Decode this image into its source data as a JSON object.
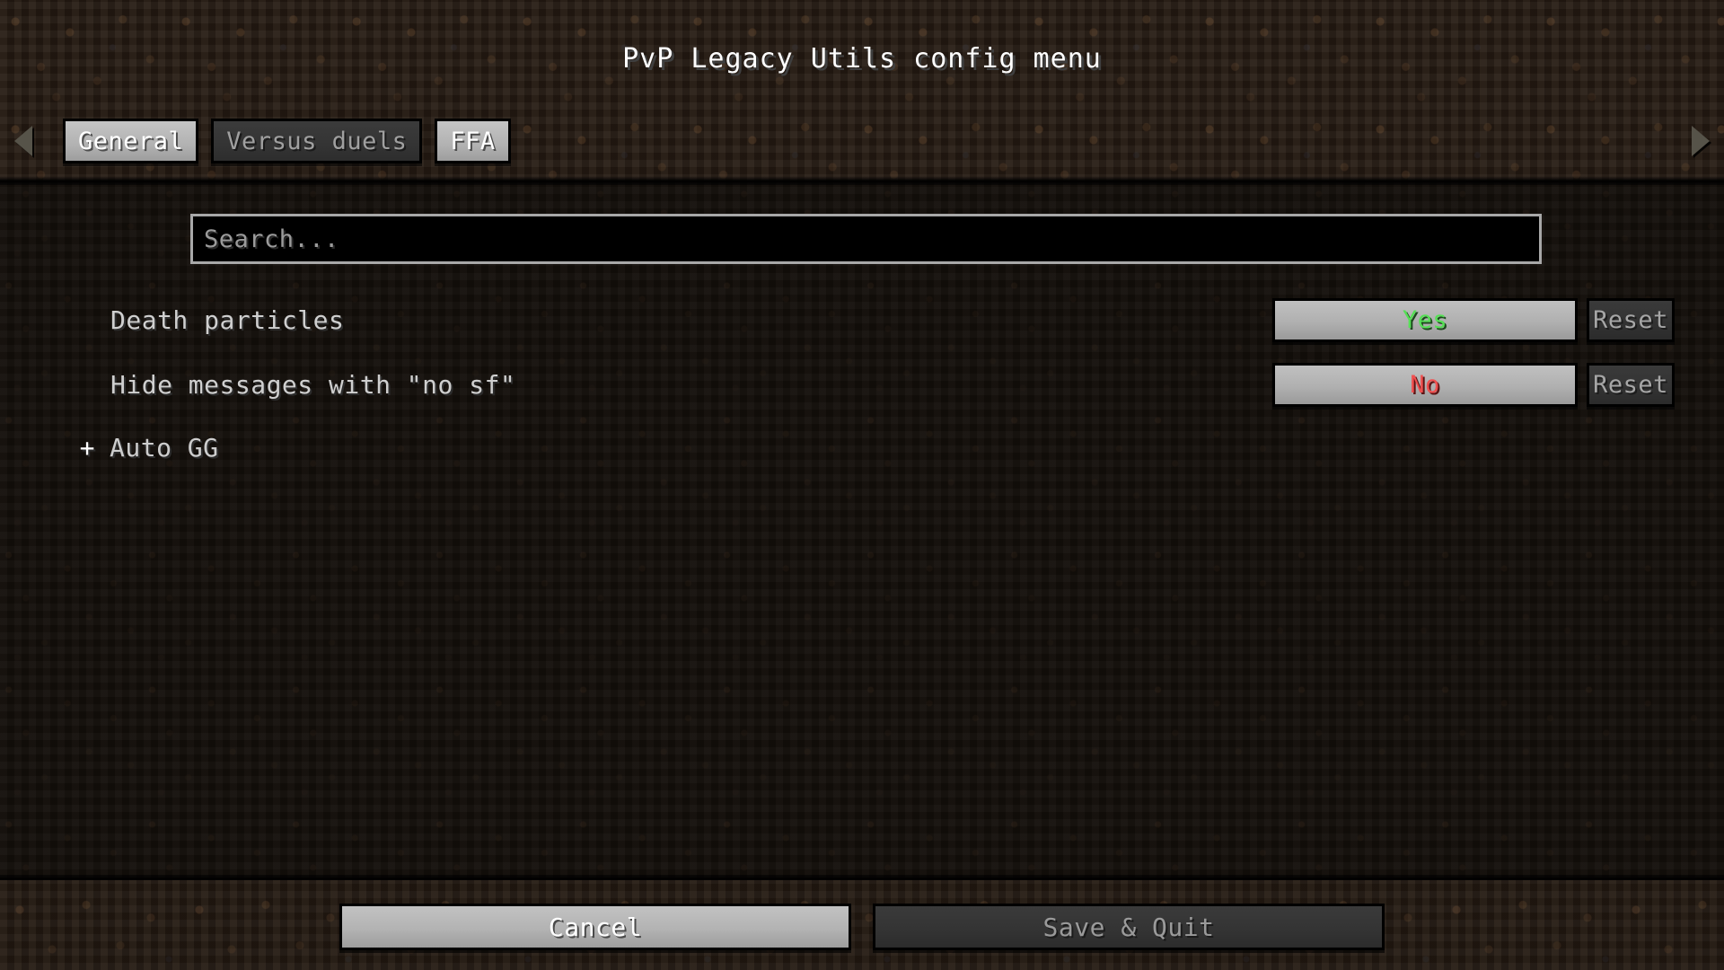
{
  "window": {
    "title": "PvP Legacy Utils config menu"
  },
  "tab_bar": {
    "prev_arrow_icon": "triangle-left-icon",
    "next_arrow_icon": "triangle-right-icon",
    "tabs": [
      {
        "label": "General",
        "state": "active"
      },
      {
        "label": "Versus duels",
        "state": "inactive"
      },
      {
        "label": "FFA",
        "state": "active"
      }
    ]
  },
  "search": {
    "placeholder": "Search...",
    "value": ""
  },
  "options": [
    {
      "label": "Death particles",
      "value": "Yes",
      "value_color": "#55e055",
      "reset_label": "Reset",
      "reset_enabled": false
    },
    {
      "label": "Hide messages with \"no sf\"",
      "value": "No",
      "value_color": "#f05050",
      "reset_label": "Reset",
      "reset_enabled": false
    }
  ],
  "categories": [
    {
      "toggle": "+",
      "label": "Auto GG",
      "expanded": false
    }
  ],
  "footer": {
    "cancel_label": "Cancel",
    "save_label": "Save & Quit",
    "save_enabled": false
  },
  "colors": {
    "background": "#120d09",
    "header_band": "#221811",
    "button_light": "#b3b3b3",
    "button_dark": "#343434",
    "text_primary": "#ffffff",
    "text_muted": "#a0a0a0",
    "yes_green": "#55e055",
    "no_red": "#f05050"
  }
}
